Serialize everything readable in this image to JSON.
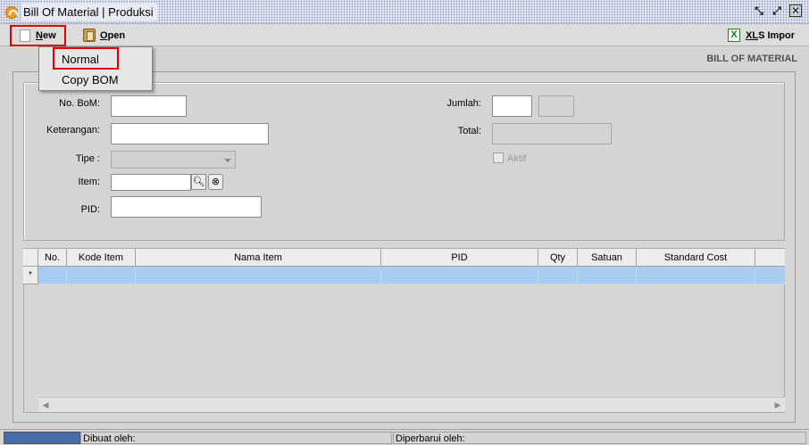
{
  "window": {
    "title": "Bill Of Material | Produksi",
    "controls": [
      "restore-icon",
      "maximize-icon",
      "close-icon"
    ]
  },
  "toolbar": {
    "new_label": "New",
    "new_underline": "N",
    "new_rest": "ew",
    "open_underline": "O",
    "open_rest": "pen",
    "xls_underline": "XL",
    "xls_rest": "S Impor"
  },
  "dropdown": {
    "items": [
      "Normal",
      "Copy BOM"
    ]
  },
  "section_title": "BILL OF MATERIAL",
  "form": {
    "no_bom_label": "No. BoM:",
    "no_bom_value": "",
    "keterangan_label": "Keterangan:",
    "keterangan_value": "",
    "tipe_label": "Tipe :",
    "tipe_value": "",
    "item_label": "Item:",
    "item_value": "",
    "pid_label": "PID:",
    "pid_value": "",
    "jumlah_label": "Jumlah:",
    "jumlah_value": "",
    "jumlah_unit": "",
    "total_label": "Total:",
    "total_value": "",
    "aktif_label": "Aktif",
    "aktif_checked": false
  },
  "grid": {
    "columns": [
      "No.",
      "Kode Item",
      "Nama Item",
      "PID",
      "Qty",
      "Satuan",
      "Standard Cost"
    ],
    "new_row_marker": "*",
    "rows": []
  },
  "status": {
    "created_label": "Dibuat oleh:",
    "updated_label": "Diperbarui oleh:"
  },
  "colors": {
    "highlight_border": "#e00000",
    "selected_row": "#a8cdf2",
    "progress": "#4a6ca8"
  }
}
